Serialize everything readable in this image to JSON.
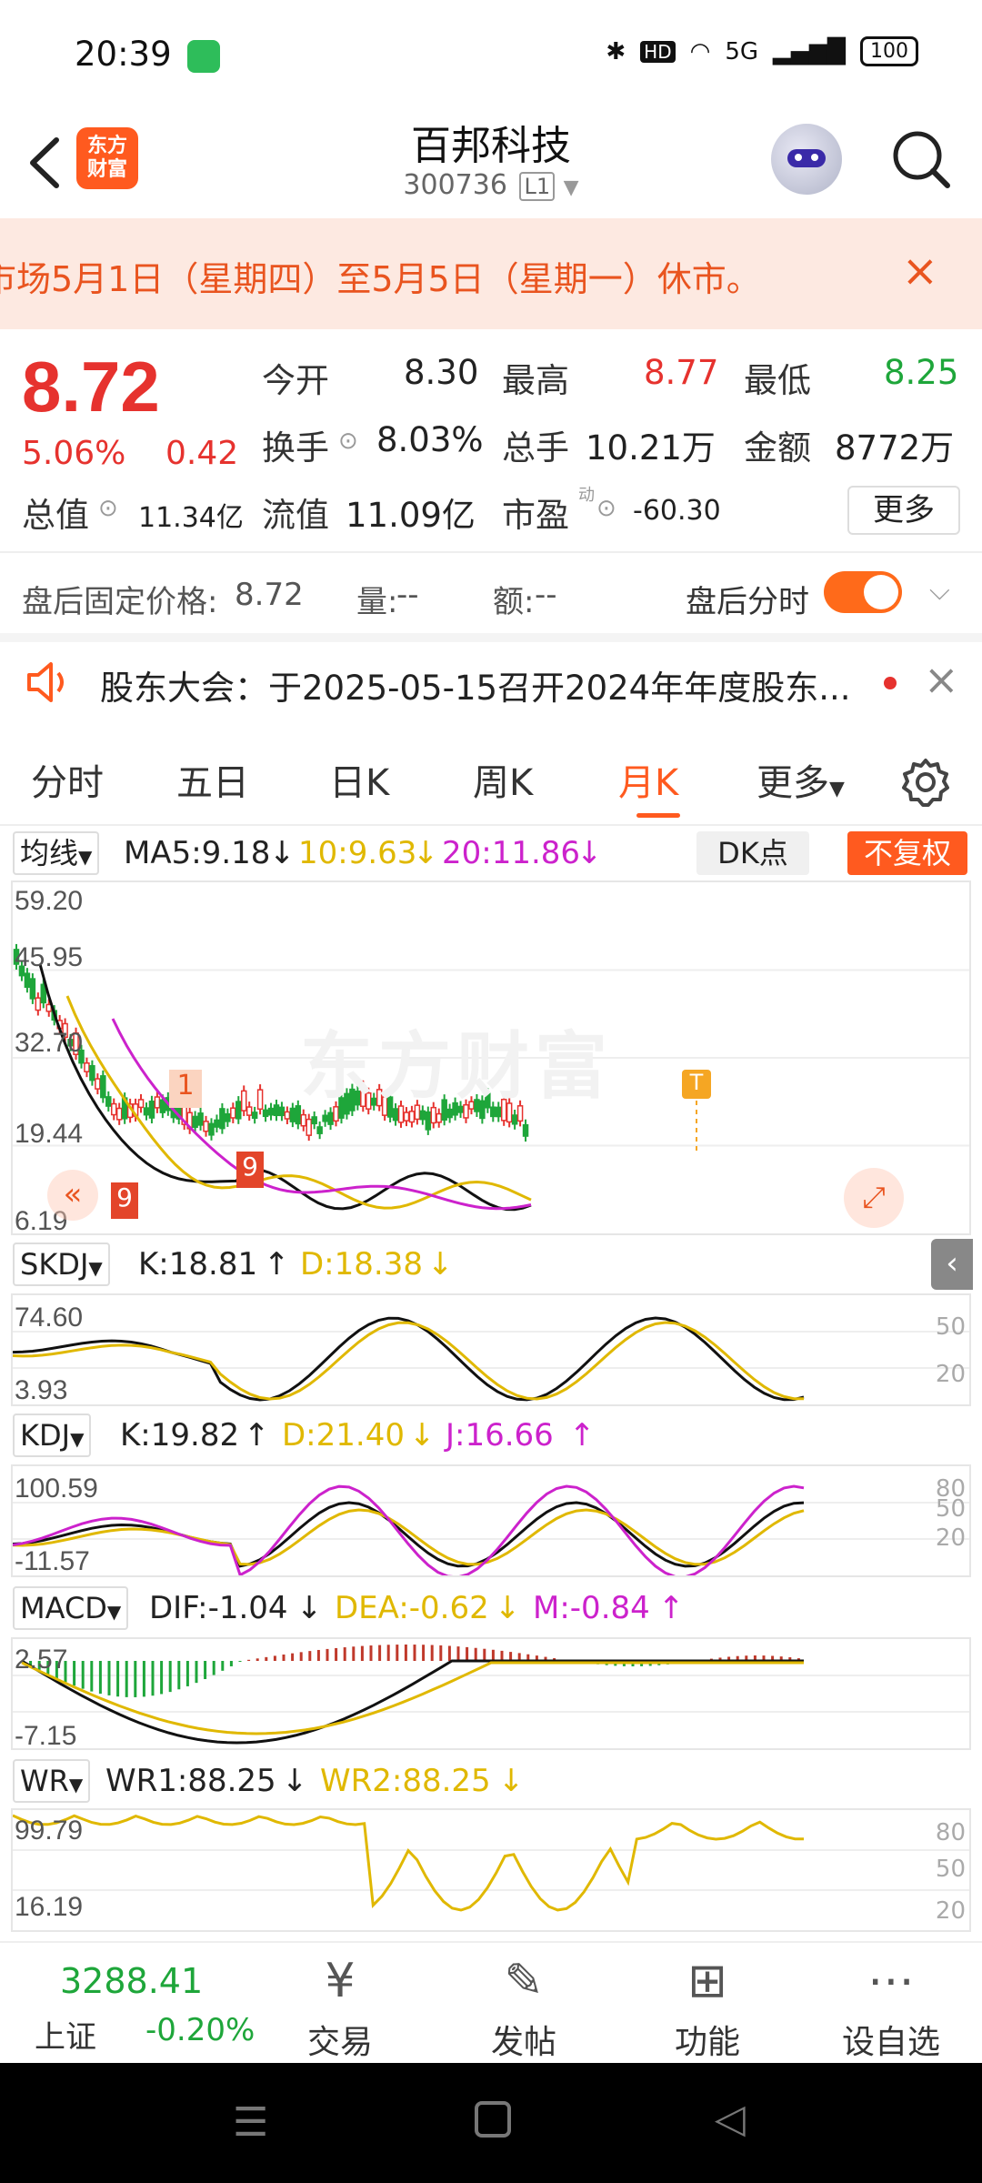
{
  "status": {
    "time": "20:39",
    "battery": "100",
    "network": "5G"
  },
  "header": {
    "logo": "东方\n财富",
    "title": "百邦科技",
    "code": "300736",
    "level": "L1"
  },
  "notice": {
    "text": "市场5月1日（星期四）至5月5日（星期一）休市。",
    "close": "×"
  },
  "quote": {
    "price": "8.72",
    "pct": "5.06%",
    "change": "0.42",
    "open_label": "今开",
    "open": "8.30",
    "high_label": "最高",
    "high": "8.77",
    "low_label": "最低",
    "low": "8.25",
    "turnover_label": "换手",
    "turnover": "8.03%",
    "vol_label": "总手",
    "vol": "10.21万",
    "amt_label": "金额",
    "amt": "8772万",
    "mcap_label": "总值",
    "mcap": "11.34亿",
    "float_label": "流值",
    "float": "11.09亿",
    "pe_label": "市盈",
    "pe_sup": "动",
    "pe": "-60.30",
    "more": "更多"
  },
  "after_hours": {
    "label": "盘后固定价格:",
    "price": "8.72",
    "vol_label": "量:",
    "vol": "--",
    "amt_label": "额:",
    "amt": "--",
    "intraday_label": "盘后分时"
  },
  "announcement": {
    "text": "股东大会：于2025-05-15召开2024年年度股东..."
  },
  "tabs": [
    "分时",
    "五日",
    "日K",
    "周K",
    "月K",
    "更多"
  ],
  "active_tab": 4,
  "main_chart": {
    "selector": "均线",
    "ma5": "MA5:9.18",
    "ma10": "10:9.63",
    "ma20": "20:11.86",
    "dk": "DK点",
    "fq": "不复权",
    "y": [
      "59.20",
      "45.95",
      "32.70",
      "19.44",
      "6.19"
    ],
    "marker1": "1",
    "marker9a": "9",
    "marker9b": "9",
    "markerT": "T",
    "watermark": "东方财富"
  },
  "skdj": {
    "name": "SKDJ",
    "k": "K:18.81",
    "d": "D:18.38",
    "y": [
      "74.60",
      "3.93"
    ],
    "r": [
      "50",
      "20"
    ]
  },
  "kdj": {
    "name": "KDJ",
    "k": "K:19.82",
    "d": "D:21.40",
    "j": "J:16.66",
    "y": [
      "100.59",
      "-11.57"
    ],
    "r": [
      "80",
      "50",
      "20"
    ]
  },
  "macd": {
    "name": "MACD",
    "dif": "DIF:-1.04",
    "dea": "DEA:-0.62",
    "m": "M:-0.84",
    "y": [
      "2.57",
      "-7.15"
    ]
  },
  "wr": {
    "name": "WR",
    "wr1": "WR1:88.25",
    "wr2": "WR2:88.25",
    "y": [
      "99.79",
      "16.19"
    ],
    "r": [
      "80",
      "50",
      "20"
    ]
  },
  "bottom": {
    "index_value": "3288.41",
    "index_name": "上证",
    "index_pct": "-0.20%",
    "items": [
      "交易",
      "发帖",
      "功能",
      "设自选"
    ]
  },
  "colors": {
    "accent": "#ff5a1f",
    "up": "#e6322e",
    "down": "#1ea63a",
    "yellow": "#e0b800",
    "magenta": "#cc22cc"
  }
}
